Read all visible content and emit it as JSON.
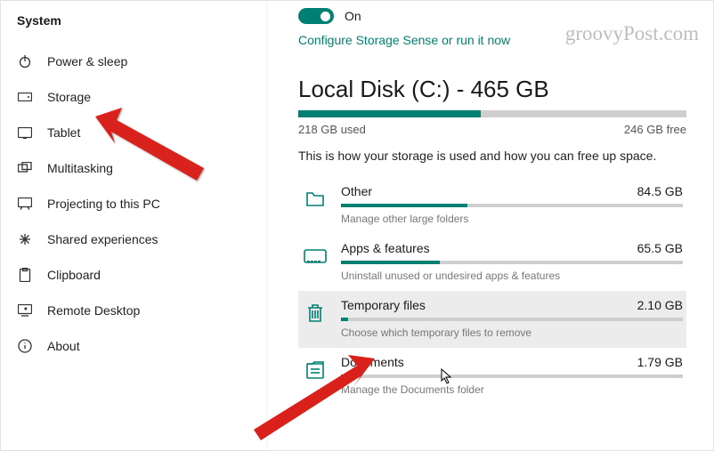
{
  "watermark": "groovyPost.com",
  "sidebar": {
    "title": "System",
    "items": [
      {
        "label": "Power & sleep"
      },
      {
        "label": "Storage"
      },
      {
        "label": "Tablet"
      },
      {
        "label": "Multitasking"
      },
      {
        "label": "Projecting to this PC"
      },
      {
        "label": "Shared experiences"
      },
      {
        "label": "Clipboard"
      },
      {
        "label": "Remote Desktop"
      },
      {
        "label": "About"
      }
    ]
  },
  "storageSense": {
    "stateLabel": "On",
    "configureLink": "Configure Storage Sense or run it now"
  },
  "disk": {
    "title": "Local Disk (C:) - 465 GB",
    "usedLabel": "218 GB used",
    "freeLabel": "246 GB free",
    "usedPercent": 47,
    "description": "This is how your storage is used and how you can free up space."
  },
  "categories": [
    {
      "name": "Other",
      "size": "84.5 GB",
      "percent": 37,
      "sub": "Manage other large folders",
      "icon": "folder"
    },
    {
      "name": "Apps & features",
      "size": "65.5 GB",
      "percent": 29,
      "sub": "Uninstall unused or undesired apps & features",
      "icon": "apps"
    },
    {
      "name": "Temporary files",
      "size": "2.10 GB",
      "percent": 2,
      "sub": "Choose which temporary files to remove",
      "icon": "trash",
      "selected": true
    },
    {
      "name": "Documents",
      "size": "1.79 GB",
      "percent": 2,
      "sub": "Manage the Documents folder",
      "icon": "document"
    }
  ]
}
